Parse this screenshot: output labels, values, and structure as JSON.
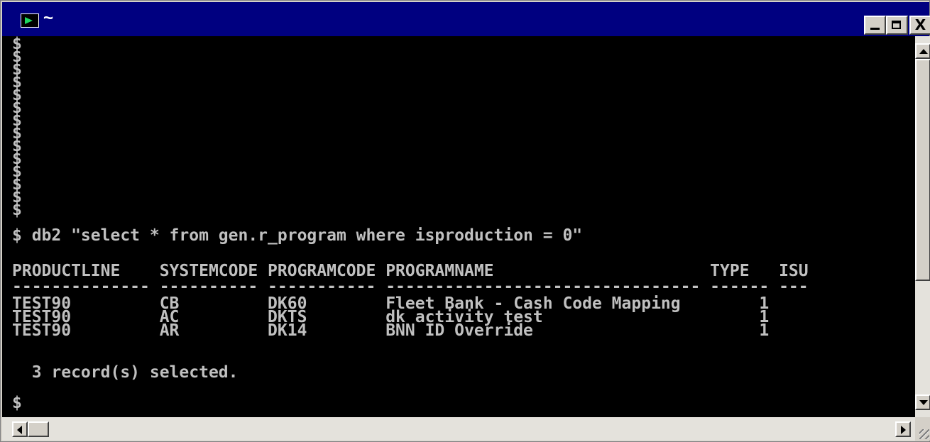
{
  "window": {
    "title": "~",
    "controls": {
      "minimize_icon": "minimize-icon",
      "maximize_icon": "maximize-icon",
      "close_label": "X"
    }
  },
  "terminal": {
    "lines": [
      "$",
      "$",
      "$",
      "$",
      "$",
      "$",
      "$",
      "$",
      "$",
      "$",
      "$",
      "$",
      "$",
      "$",
      "$ db2 \"select * from gen.r_program where isproduction = 0\"",
      "",
      "PRODUCTLINE    SYSTEMCODE PROGRAMCODE PROGRAMNAME                      TYPE   ISU",
      "-------------- ---------- ----------- -------------------------------- ------ ---",
      "TEST90         CB         DK60        Fleet Bank - Cash Code Mapping        1",
      "TEST90         AC         DKTS        dk activity test                      1",
      "TEST90         AR         DK14        BNN ID Override                       1",
      "",
      "  3 record(s) selected.",
      "",
      "$"
    ]
  },
  "colors": {
    "titlebar": "#000080",
    "terminal_bg": "#000000",
    "terminal_fg": "#c0c0c0",
    "prompt_icon": "#1ed760",
    "chrome": "#d4d0c8"
  }
}
